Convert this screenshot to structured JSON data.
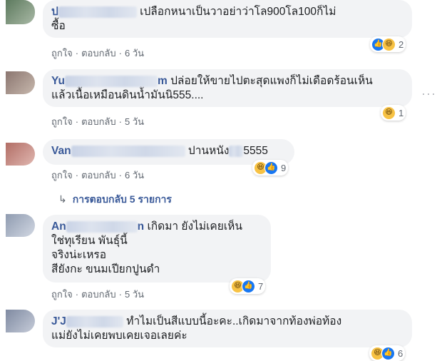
{
  "comments": [
    {
      "name": "ป",
      "text_line1": "เปลือกหนาเป็นวาอย่าว่าโล900โล100ก็ไม่",
      "text_line2": "ซื้อ",
      "like": "ถูกใจ",
      "reply": "ตอบกลับ",
      "time": "6 วัน",
      "reactions": [
        "like-icon",
        "haha-icon"
      ],
      "reaction_count": "2",
      "avatar_colors": [
        "#5d7a5e",
        "#a9b9a6"
      ]
    },
    {
      "name": "Yu",
      "name_tail": "m",
      "text_line1": "ปล่อยให้ขายไปตะสุดแพงก็ไม่เดือดร้อนเห็น",
      "text_line2": "แล้วเนื้อเหมือนดินน้ำมันนิ555....",
      "like": "ถูกใจ",
      "reply": "ตอบกลับ",
      "time": "5 วัน",
      "reactions": [
        "haha-icon"
      ],
      "reaction_count": "1",
      "avatar_colors": [
        "#8b7670",
        "#c7b8ad"
      ]
    },
    {
      "name": "Van",
      "text_line1": "ปานหนัง",
      "text_tail": "5555",
      "like": "ถูกใจ",
      "reply": "ตอบกลับ",
      "time": "6 วัน",
      "reactions": [
        "haha-icon",
        "like-icon"
      ],
      "reaction_count": "9",
      "avatar_colors": [
        "#b26e66",
        "#e0b7b0"
      ]
    },
    {
      "name": "An",
      "name_tail": "n",
      "text_line1": "เกิดมา ยังไม่เคยเห็น",
      "text_line2": "ใช่ทุเรียน พันธุ์นี้",
      "text_line3": "จริงน่ะเหรอ",
      "text_line4": "สียังกะ ขนมเปียกปูนดำ",
      "like": "ถูกใจ",
      "reply": "ตอบกลับ",
      "time": "5 วัน",
      "reactions": [
        "haha-icon",
        "like-icon"
      ],
      "reaction_count": "7",
      "avatar_colors": [
        "#8f9bb0",
        "#d2d8e3"
      ]
    },
    {
      "name": "J'J",
      "text_line1": "ทำไมเป็นสีแบบนี้อะคะ..เกิดมาจากท้องพ่อท้อง",
      "text_line2": "แม่ยังไม่เคยพบเคยเจอเลยค่ะ",
      "reactions": [
        "haha-icon",
        "like-icon"
      ],
      "reaction_count": "6",
      "avatar_colors": [
        "#7f8aa1",
        "#c6ccd9"
      ]
    }
  ],
  "replies_link": "การตอบกลับ 5 รายการ",
  "replies_arrow": "↳",
  "more_menu": "···",
  "icons": {
    "like": "👍",
    "haha": "😆"
  },
  "colors": {
    "link": "#385898",
    "meta": "#606770",
    "bubble": "#f2f3f5"
  }
}
